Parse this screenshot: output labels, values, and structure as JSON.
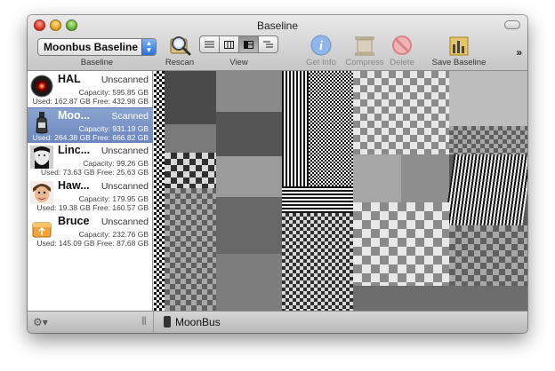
{
  "window": {
    "title": "Baseline"
  },
  "toolbar": {
    "baseline_selected": "Moonbus Baseline ...",
    "baseline_label": "Baseline",
    "rescan_label": "Rescan",
    "view_label": "View",
    "view_modes": [
      "list-view",
      "column-view",
      "treemap-view",
      "outline-view"
    ],
    "view_active": 2,
    "getinfo_label": "Get Info",
    "compress_label": "Compress",
    "delete_label": "Delete",
    "save_baseline_label": "Save Baseline",
    "overflow_label": "»"
  },
  "volumes": [
    {
      "name": "HAL",
      "status": "Unscanned",
      "capacity": "Capacity: 595.85 GB",
      "used_free": "Used: 162.87 GB Free: 432.98 GB",
      "icon": "hal-eye-icon",
      "selected": false
    },
    {
      "name": "Moo...",
      "status": "Scanned",
      "capacity": "Capacity: 931.19 GB",
      "used_free": "Used: 264.38 GB Free: 666.82 GB",
      "icon": "bottle-drive-icon",
      "selected": true
    },
    {
      "name": "Linc...",
      "status": "Unscanned",
      "capacity": "Capacity: 99.26 GB",
      "used_free": "Used: 73.63 GB Free: 25.63 GB",
      "icon": "lincoln-portrait-icon",
      "selected": false
    },
    {
      "name": "Haw...",
      "status": "Unscanned",
      "capacity": "Capacity: 179.95 GB",
      "used_free": "Used: 19.38 GB Free: 160.57 GB",
      "icon": "face-portrait-icon",
      "selected": false
    },
    {
      "name": "Bruce",
      "status": "Unscanned",
      "capacity": "Capacity: 232.76 GB",
      "used_free": "Used: 145.09 GB Free: 87.68 GB",
      "icon": "usb-drive-icon",
      "selected": false
    }
  ],
  "statusbar": {
    "current_volume": "MoonBus",
    "action_icon": "gear-icon"
  }
}
